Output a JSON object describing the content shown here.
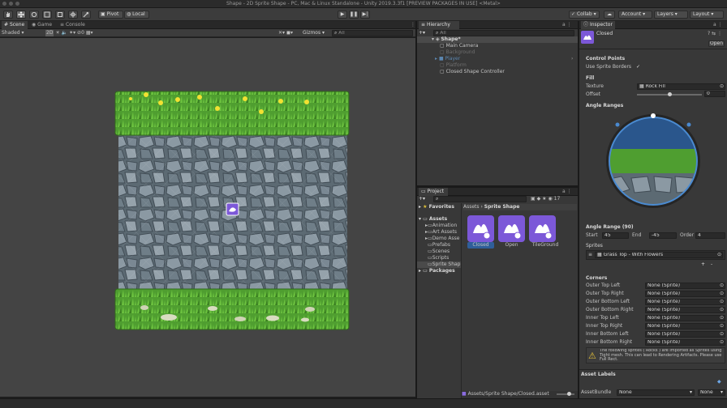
{
  "window": {
    "title": "Shape - 2D Sprite Shape - PC, Mac & Linux Standalone - Unity 2019.3.3f1 [PREVIEW PACKAGES IN USE] <Metal>"
  },
  "toolbar": {
    "pivot_label": "Pivot",
    "local_label": "Local",
    "collab_label": "Collab",
    "account_label": "Account",
    "layers_label": "Layers",
    "layout_label": "Layout"
  },
  "scene": {
    "tabs": [
      "Scene",
      "Game",
      "Console"
    ],
    "shading_mode": "Shaded",
    "gizmos_label": "Gizmos",
    "search_placeholder": "All"
  },
  "hierarchy": {
    "tab_label": "Hierarchy",
    "search_placeholder": "All",
    "items": [
      {
        "label": "Shape*",
        "style": "root"
      },
      {
        "label": "Main Camera",
        "style": "normal"
      },
      {
        "label": "Background",
        "style": "inactive"
      },
      {
        "label": "Player",
        "style": "prefab"
      },
      {
        "label": "Platform",
        "style": "inactive"
      },
      {
        "label": "Closed Shape Controller",
        "style": "normal"
      }
    ]
  },
  "project": {
    "tab_label": "Project",
    "counter": "17",
    "favorites_label": "Favorites",
    "assets_label": "Assets",
    "folders": [
      "Animation",
      "Art Assets",
      "Demo Asse",
      "Prefabs",
      "Scenes",
      "Scripts",
      "Sprite Shap"
    ],
    "packages_label": "Packages",
    "breadcrumb_root": "Assets",
    "breadcrumb_sep": "›",
    "breadcrumb_current": "Sprite Shape",
    "assets": [
      "Closed",
      "Open",
      "TileGround"
    ],
    "footer_path": "Assets/Sprite Shape/Closed.asset"
  },
  "inspector": {
    "tab_label": "Inspector",
    "object_name": "Closed",
    "open_button": "Open",
    "control_points_header": "Control Points",
    "use_sprite_borders_label": "Use Sprite Borders",
    "use_sprite_borders_checked": true,
    "fill_header": "Fill",
    "texture_label": "Texture",
    "texture_value": "Rock Fill",
    "offset_label": "Offset",
    "offset_value": "0",
    "offset_fraction": 0.5,
    "angle_ranges_header": "Angle Ranges",
    "angle_range_label": "Angle Range (90)",
    "start_label": "Start",
    "start_value": "45",
    "end_label": "End",
    "end_value": "-45",
    "order_label": "Order",
    "order_value": "4",
    "sprites_label": "Sprites",
    "sprite_item": "Grass Top - With Flowers",
    "add_button": "+",
    "remove_button": "-",
    "corners_header": "Corners",
    "corners": [
      {
        "label": "Outer Top Left",
        "value": "None (Sprite)"
      },
      {
        "label": "Outer Top Right",
        "value": "None (Sprite)"
      },
      {
        "label": "Outer Bottom Left",
        "value": "None (Sprite)"
      },
      {
        "label": "Outer Bottom Right",
        "value": "None (Sprite)"
      },
      {
        "label": "Inner Top Left",
        "value": "None (Sprite)"
      },
      {
        "label": "Inner Top Right",
        "value": "None (Sprite)"
      },
      {
        "label": "Inner Bottom Left",
        "value": "None (Sprite)"
      },
      {
        "label": "Inner Bottom Right",
        "value": "None (Sprite)"
      }
    ],
    "warning_text": "The following sprites ( Rocks ) are imported as Sprites using Tight mesh. This can lead to Rendering Artifacts. Please use Full Rect.",
    "asset_labels_header": "Asset Labels",
    "assetbundle_label": "AssetBundle",
    "assetbundle_value": "None",
    "assetbundle_variant": "None"
  },
  "colors": {
    "accent": "#2f6db5",
    "asset_purple": "#7c58d8",
    "grass": "#4a9e2e",
    "rock": "#5f6e78"
  }
}
